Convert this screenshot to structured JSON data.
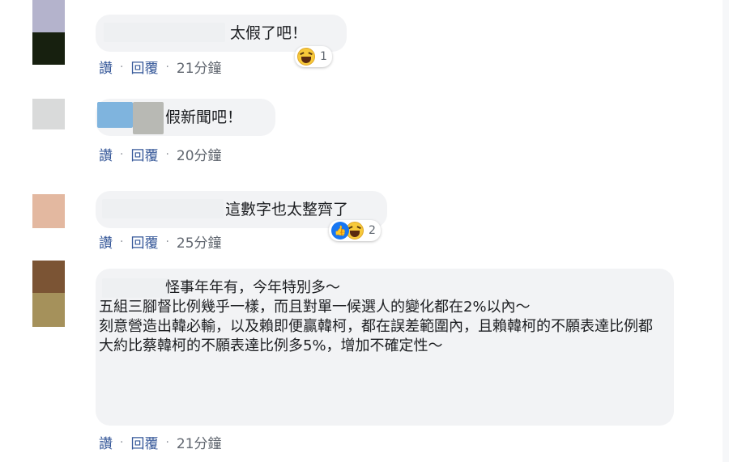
{
  "comments": [
    {
      "text": "太假了吧！",
      "actions": {
        "like": "讚",
        "reply": "回覆",
        "time": "21分鐘"
      },
      "reaction_count": "1",
      "reactions": [
        "haha-icon"
      ],
      "avatar_colors": [
        "#b4b3cc",
        "#17200f"
      ]
    },
    {
      "text": "假新聞吧！",
      "actions": {
        "like": "讚",
        "reply": "回覆",
        "time": "20分鐘"
      },
      "avatar_colors": [
        "#d9dada"
      ]
    },
    {
      "text": "這數字也太整齊了",
      "actions": {
        "like": "讚",
        "reply": "回覆",
        "time": "25分鐘"
      },
      "reaction_count": "2",
      "reactions": [
        "like-icon",
        "haha-icon"
      ],
      "avatar_colors": [
        "#e3b8a0"
      ]
    },
    {
      "text": "怪事年年有，今年特別多～\n五組三腳督比例幾乎一樣，而且對單一候選人的變化都在2%以內～\n刻意營造出韓必輸，以及賴即便贏韓柯，都在誤差範圍內，且賴韓柯的不願表達比例都大約比蔡韓柯的不願表達比例多5%，增加不確定性～",
      "actions": {
        "like": "讚",
        "reply": "回覆",
        "time": "21分鐘"
      },
      "avatar_colors": [
        "#7b5434",
        "#a5915b"
      ]
    }
  ],
  "separator": "·",
  "colors": {
    "bubble": "#f2f3f5",
    "link": "#365899",
    "time": "#616770"
  }
}
